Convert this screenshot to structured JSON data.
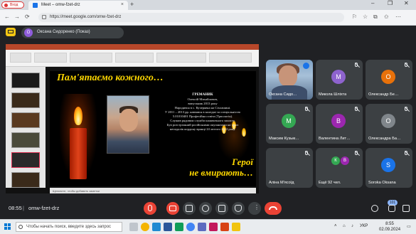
{
  "browser": {
    "profile_label": "Вход",
    "tab_title": "Meet – omw-fzet-drz",
    "tab_close": "×",
    "new_tab": "+",
    "url": "https://meet.google.com/omw-fzet-drz",
    "win_min": "–",
    "win_max": "❐",
    "win_close": "✕",
    "back": "←",
    "forward": "→",
    "reload": "⟳"
  },
  "meet": {
    "presenter_initial": "О",
    "presenter_label": "Оксана Сидоренко (Показ)",
    "time": "08:55",
    "separator": "|",
    "meeting_code": "omw-fzet-drz",
    "participant_count": "101"
  },
  "slide": {
    "title": "Пам'ятаємо кожного…",
    "surname": "ГРЕМАНИК",
    "name": "Олексій Михайлович,",
    "grad": "випускник 2013 року",
    "bio_lines": [
      "Народився в с. Кучерявка на Сіхлашині.",
      "У 2011 – 2013 рр. навчався в коледжі за спеціальністю",
      "5.01010401 Професійна освіта (Трпологія).",
      "Служив рядовим служби шашвичного захисту.",
      "Був розстріляний російськими окупантами на трасі",
      "неподалік кордону вранці 24 лютого 2022 року."
    ],
    "footer_line1": "Герої",
    "footer_line2": "не вмирають…",
    "status_text": "Щелкните, чтобы добавить заметки"
  },
  "participants": [
    {
      "name": "Оксана Сидо…",
      "initial": "",
      "color": "#1a73e8"
    },
    {
      "name": "Микола Шліхта",
      "initial": "М",
      "color": "#8e63ce"
    },
    {
      "name": "Олександр Бе…",
      "initial": "О",
      "color": "#e8710a"
    },
    {
      "name": "Максим Кузьм…",
      "initial": "М",
      "color": "#34a853"
    },
    {
      "name": "Валентина Лит…",
      "initial": "В",
      "color": "#9c27b0"
    },
    {
      "name": "Олександра Ба…",
      "initial": "О",
      "color": "#80868b"
    },
    {
      "name": "Аліна М'ясоїд",
      "initial": "",
      "color": "#3c4043"
    },
    {
      "name": "Ещё 92 чел.",
      "initial": "К",
      "color": "#34a853"
    },
    {
      "name": "Soroka Oksana",
      "initial": "S",
      "color": "#1a73e8"
    }
  ],
  "more_tile": {
    "initial_b": "В"
  },
  "taskbar": {
    "search_placeholder": "Чтобы начать поиск, введите здесь запрос",
    "lang": "УКР",
    "time": "8:55",
    "date": "02.09.2024"
  },
  "colors": {
    "meet_bg": "#202124",
    "tile_bg": "#3c4043",
    "hangup": "#ea4335",
    "slide_gold": "#ffd800"
  }
}
